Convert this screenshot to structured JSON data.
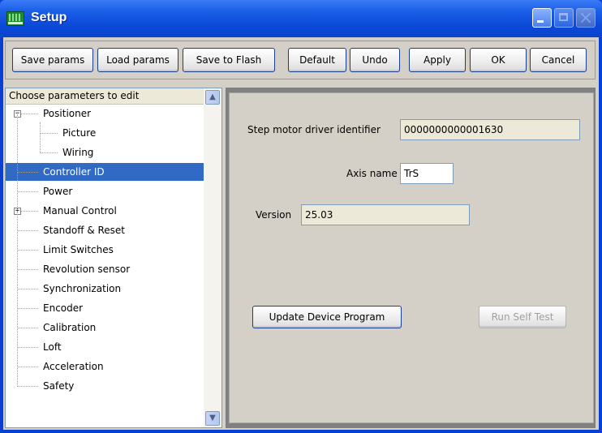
{
  "window": {
    "title": "Setup"
  },
  "toolbar": {
    "save_params": "Save params",
    "load_params": "Load params",
    "save_to_flash": "Save to Flash",
    "default": "Default",
    "undo": "Undo",
    "apply": "Apply",
    "ok": "OK",
    "cancel": "Cancel"
  },
  "tree": {
    "header": "Choose parameters to edit",
    "items": [
      {
        "label": "Positioner",
        "level": 0,
        "expander": "minus"
      },
      {
        "label": "Picture",
        "level": 1
      },
      {
        "label": "Wiring",
        "level": 1
      },
      {
        "label": "Controller ID",
        "level": 0,
        "selected": true
      },
      {
        "label": "Power",
        "level": 0
      },
      {
        "label": "Manual Control",
        "level": 0,
        "expander": "plus"
      },
      {
        "label": "Standoff & Reset",
        "level": 0
      },
      {
        "label": "Limit Switches",
        "level": 0
      },
      {
        "label": "Revolution sensor",
        "level": 0
      },
      {
        "label": "Synchronization",
        "level": 0
      },
      {
        "label": "Encoder",
        "level": 0
      },
      {
        "label": "Calibration",
        "level": 0
      },
      {
        "label": "Loft",
        "level": 0
      },
      {
        "label": "Acceleration",
        "level": 0
      },
      {
        "label": "Safety",
        "level": 0
      }
    ]
  },
  "panel": {
    "driver_id_label": "Step motor driver identifier",
    "driver_id_value": "0000000000001630",
    "axis_name_label": "Axis name",
    "axis_name_value": "TrS",
    "version_label": "Version",
    "version_value": "25.03",
    "update_button": "Update Device Program",
    "self_test_button": "Run Self Test"
  },
  "colors": {
    "titlebar": "#0b49d8",
    "selection": "#316ac5",
    "dialog_bg": "#d4d0c8"
  }
}
